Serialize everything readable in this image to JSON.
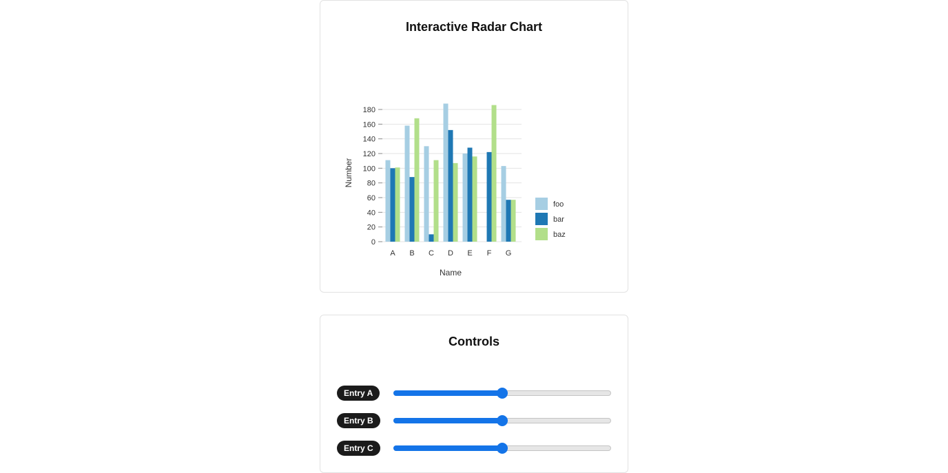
{
  "chart_card": {
    "title": "Interactive Radar Chart"
  },
  "chart_data": {
    "type": "bar",
    "categories": [
      "A",
      "B",
      "C",
      "D",
      "E",
      "F",
      "G"
    ],
    "series": [
      {
        "name": "foo",
        "color": "#a6cee3",
        "values": [
          111,
          158,
          130,
          188,
          120,
          0,
          103
        ]
      },
      {
        "name": "bar",
        "color": "#1f78b4",
        "values": [
          100,
          88,
          10,
          152,
          128,
          122,
          57
        ]
      },
      {
        "name": "baz",
        "color": "#b2df8a",
        "values": [
          101,
          168,
          111,
          107,
          116,
          186,
          57
        ]
      }
    ],
    "xlabel": "Name",
    "ylabel": "Number",
    "yticks": [
      0,
      20,
      40,
      60,
      80,
      100,
      120,
      140,
      160,
      180
    ],
    "ylim": [
      0,
      190
    ],
    "grid": "horizontal",
    "legend_position": "bottom-right"
  },
  "controls_card": {
    "title": "Controls",
    "sliders": [
      {
        "label": "Entry A",
        "value": 0.5
      },
      {
        "label": "Entry B",
        "value": 0.5
      },
      {
        "label": "Entry C",
        "value": 0.5
      }
    ]
  },
  "colors": {
    "slider_accent": "#1474e8",
    "badge_background": "#1b1b1b"
  }
}
